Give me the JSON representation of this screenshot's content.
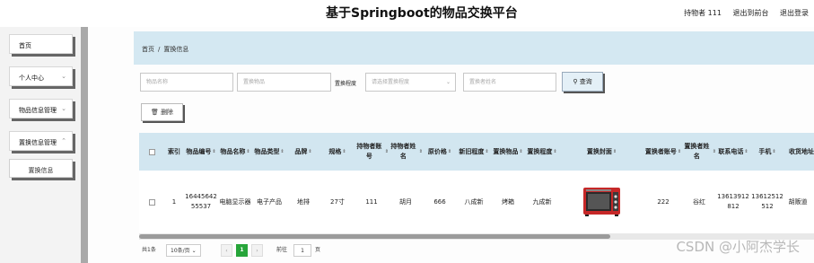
{
  "header": {
    "title": "基于Springboot的物品交换平台",
    "user": "持物者 111",
    "back_to_front": "退出到前台",
    "logout": "退出登录"
  },
  "sidebar": {
    "items": [
      {
        "label": "首页",
        "has_chevron": false
      },
      {
        "label": "个人中心",
        "has_chevron": true
      },
      {
        "label": "物品信息管理",
        "has_chevron": true
      },
      {
        "label": "置换信息管理",
        "has_chevron": true
      }
    ],
    "sub_item": "置换信息"
  },
  "breadcrumb": {
    "home": "首页",
    "separator": "/",
    "current": "置换信息"
  },
  "search": {
    "item_name_placeholder": "物品名称",
    "swap_item_placeholder": "置换物品",
    "swap_level_label": "置换程度",
    "swap_level_placeholder": "请选择置换程度",
    "swapper_name_placeholder": "置换者姓名",
    "search_button": "查询"
  },
  "actions": {
    "delete_button": "删除"
  },
  "table": {
    "columns": [
      "",
      "索引",
      "物品编号",
      "物品名称",
      "物品类型",
      "品牌",
      "规格",
      "持物者账号",
      "持物者姓名",
      "原价格",
      "新旧程度",
      "置换物品",
      "置换程度",
      "置换封面",
      "置换者账号",
      "置换者姓名",
      "联系电话",
      "手机",
      "收货地址"
    ],
    "rows": [
      {
        "index": "1",
        "item_no": "1644564255537",
        "item_name": "电脑显示器",
        "item_type": "电子产品",
        "brand": "地排",
        "spec": "27寸",
        "owner_account": "111",
        "owner_name": "胡月",
        "original_price": "666",
        "condition": "八成新",
        "swap_item": "烤箱",
        "swap_level": "九成新",
        "cover_icon": "oven-image",
        "swapper_account": "222",
        "swapper_name": "谷红",
        "phone": "13613912812",
        "mobile": "13612512512",
        "address": "胡贩道"
      }
    ]
  },
  "pagination": {
    "total": "共1条",
    "page_size": "10条/页",
    "current_page": "1",
    "goto_label": "前往",
    "goto_value": "1",
    "page_unit": "页"
  },
  "watermark": "CSDN @小阿杰学长",
  "colors": {
    "header_bar": "#d4e8f2",
    "page_active": "#27a53a",
    "sidebar_rail": "#a9a9a9"
  }
}
